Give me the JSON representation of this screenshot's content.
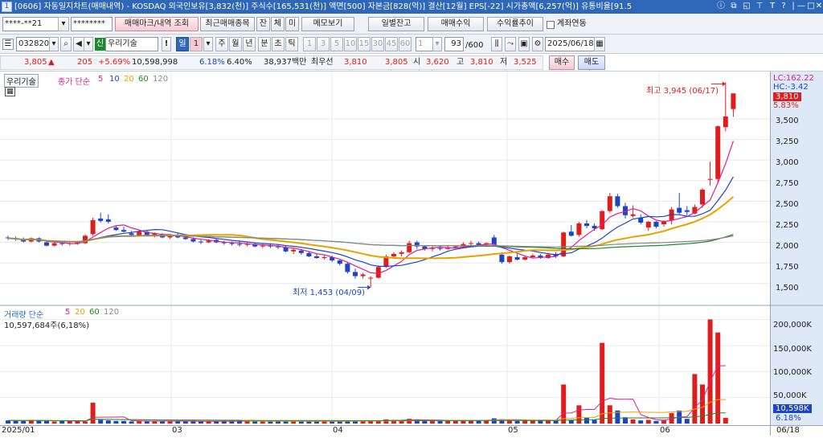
{
  "window": {
    "number": "1",
    "title": "[0606] 자동일지차트(매매내역) - KOSDAQ 외국인보유[3,832(천)] 주식수[165,531(천)] 액면[500] 자본금[828(억)] 결산[12월] EPS[-22] 시가총액[6,257(억)] 유통비율[91.5",
    "controls": [
      "ⓘ",
      "⧉",
      "◱",
      "⊤",
      "T",
      "?",
      "|",
      "—",
      "□",
      "✕"
    ]
  },
  "toolbar1": {
    "account": "****-**21",
    "password": "********",
    "buttons": [
      "매매마크/내역 조회",
      "최근매매종목",
      "잔",
      "체",
      "미",
      "메모보기",
      "일별잔고",
      "매매수익",
      "수익률추이"
    ],
    "checkbox_label": "계좌연동"
  },
  "toolbar2": {
    "code": "032820",
    "new_badge": "신",
    "stock_name": "우리기술",
    "periods": [
      "일",
      "1",
      "주",
      "월",
      "년",
      "분",
      "초",
      "틱"
    ],
    "intervals": [
      "1",
      "3",
      "5",
      "10",
      "15",
      "30",
      "45",
      "60"
    ],
    "interval_value": "1",
    "count": "93",
    "count_total": "/600",
    "date": "2025/06/18"
  },
  "quote": {
    "price": "3,805",
    "up_mark": "▲",
    "change": "205",
    "change_pct": "+5.69%",
    "volume": "10,598,998",
    "turnover": "6.18%",
    "ratio": "6.40%",
    "amount": "38,937백만",
    "best_ask_label": "최우선",
    "best_ask": "3,810",
    "best_bid": "3,805",
    "open_label": "시",
    "open": "3,620",
    "high_label": "고",
    "high": "3,810",
    "low_label": "저",
    "low": "3,525",
    "buy_button": "매수",
    "sell_button": "매도"
  },
  "price_pane": {
    "stock_label": "우리기술",
    "legend_title": "종가 단순",
    "legend_periods": [
      "5",
      "10",
      "20",
      "60",
      "120"
    ],
    "legend_colors": [
      "#e01d8a",
      "#1b44c8",
      "#e8a200",
      "#1b8a2a",
      "#888888"
    ],
    "lc_label": "LC:162.22",
    "hc_label": "HC:-3.42",
    "current_price_label": "3,810",
    "current_pct_label": "5.83%",
    "high_annotation": "최고 3,945 (06/17)",
    "low_annotation": "최저 1,453 (04/09)",
    "y_ticks": [
      "3,500",
      "3,250",
      "3,000",
      "2,750",
      "2,500",
      "2,250",
      "2,000",
      "1,750",
      "1,500"
    ]
  },
  "volume_pane": {
    "legend_title": "거래량 단순",
    "legend_periods": [
      "5",
      "20",
      "60",
      "120"
    ],
    "volume_text": "10,597,684주(6,18%)",
    "current_volume_label": "10,598K",
    "current_pct_label": "6.18%",
    "y_ticks": [
      "200,000K",
      "150,000K",
      "100,000K",
      "50,000K"
    ]
  },
  "x_axis": {
    "labels": [
      "2025/01",
      "03",
      "04",
      "05",
      "06",
      "06/18"
    ]
  },
  "chart_data": {
    "type": "candlestick",
    "title": "우리기술",
    "price_axis": {
      "min": 1400,
      "max": 3900
    },
    "volume_axis": {
      "min": 0,
      "max": 210000
    },
    "volume_unit": "K",
    "candles": [
      {
        "o": 2060,
        "h": 2080,
        "l": 2030,
        "c": 2050
      },
      {
        "o": 2050,
        "h": 2070,
        "l": 2020,
        "c": 2040
      },
      {
        "o": 2040,
        "h": 2060,
        "l": 2000,
        "c": 2010
      },
      {
        "o": 2010,
        "h": 2060,
        "l": 2000,
        "c": 2050
      },
      {
        "o": 2050,
        "h": 2060,
        "l": 2000,
        "c": 2010
      },
      {
        "o": 2000,
        "h": 2010,
        "l": 1950,
        "c": 1960
      },
      {
        "o": 1960,
        "h": 2000,
        "l": 1950,
        "c": 1990
      },
      {
        "o": 1990,
        "h": 2010,
        "l": 1960,
        "c": 1980
      },
      {
        "o": 1980,
        "h": 2000,
        "l": 1960,
        "c": 1990
      },
      {
        "o": 1990,
        "h": 2020,
        "l": 1970,
        "c": 2000
      },
      {
        "o": 1990,
        "h": 2100,
        "l": 1980,
        "c": 2080
      },
      {
        "o": 2100,
        "h": 2300,
        "l": 2080,
        "c": 2270
      },
      {
        "o": 2290,
        "h": 2360,
        "l": 2240,
        "c": 2260
      },
      {
        "o": 2280,
        "h": 2340,
        "l": 2230,
        "c": 2250
      },
      {
        "o": 2180,
        "h": 2200,
        "l": 2140,
        "c": 2150
      },
      {
        "o": 2150,
        "h": 2190,
        "l": 2120,
        "c": 2130
      },
      {
        "o": 2110,
        "h": 2140,
        "l": 2070,
        "c": 2090
      },
      {
        "o": 2080,
        "h": 2150,
        "l": 2070,
        "c": 2130
      },
      {
        "o": 2130,
        "h": 2140,
        "l": 2070,
        "c": 2090
      },
      {
        "o": 2090,
        "h": 2120,
        "l": 2060,
        "c": 2110
      },
      {
        "o": 2100,
        "h": 2110,
        "l": 2050,
        "c": 2060
      },
      {
        "o": 2060,
        "h": 2100,
        "l": 2040,
        "c": 2080
      },
      {
        "o": 2090,
        "h": 2110,
        "l": 2050,
        "c": 2060
      },
      {
        "o": 2060,
        "h": 2080,
        "l": 2030,
        "c": 2040
      },
      {
        "o": 2040,
        "h": 2060,
        "l": 2000,
        "c": 2010
      },
      {
        "o": 2010,
        "h": 2030,
        "l": 1980,
        "c": 2000
      },
      {
        "o": 2000,
        "h": 2040,
        "l": 1990,
        "c": 2020
      },
      {
        "o": 2030,
        "h": 2050,
        "l": 1990,
        "c": 2000
      },
      {
        "o": 2000,
        "h": 2020,
        "l": 1970,
        "c": 1990
      },
      {
        "o": 1990,
        "h": 2010,
        "l": 1960,
        "c": 1980
      },
      {
        "o": 1980,
        "h": 2010,
        "l": 1950,
        "c": 1970
      },
      {
        "o": 1970,
        "h": 2000,
        "l": 1950,
        "c": 1980
      },
      {
        "o": 1980,
        "h": 2000,
        "l": 1940,
        "c": 1950
      },
      {
        "o": 1950,
        "h": 1980,
        "l": 1930,
        "c": 1960
      },
      {
        "o": 1960,
        "h": 1990,
        "l": 1930,
        "c": 1950
      },
      {
        "o": 1950,
        "h": 1970,
        "l": 1920,
        "c": 1940
      },
      {
        "o": 1940,
        "h": 1960,
        "l": 1880,
        "c": 1890
      },
      {
        "o": 1890,
        "h": 1930,
        "l": 1860,
        "c": 1910
      },
      {
        "o": 1900,
        "h": 1920,
        "l": 1850,
        "c": 1870
      },
      {
        "o": 1870,
        "h": 1890,
        "l": 1820,
        "c": 1830
      },
      {
        "o": 1830,
        "h": 1860,
        "l": 1800,
        "c": 1810
      },
      {
        "o": 1810,
        "h": 1850,
        "l": 1790,
        "c": 1820
      },
      {
        "o": 1820,
        "h": 1840,
        "l": 1760,
        "c": 1780
      },
      {
        "o": 1780,
        "h": 1800,
        "l": 1720,
        "c": 1740
      },
      {
        "o": 1740,
        "h": 1760,
        "l": 1620,
        "c": 1640
      },
      {
        "o": 1640,
        "h": 1680,
        "l": 1560,
        "c": 1590
      },
      {
        "o": 1590,
        "h": 1630,
        "l": 1560,
        "c": 1610
      },
      {
        "o": 1560,
        "h": 1590,
        "l": 1453,
        "c": 1570
      },
      {
        "o": 1570,
        "h": 1720,
        "l": 1560,
        "c": 1700
      },
      {
        "o": 1700,
        "h": 1850,
        "l": 1690,
        "c": 1830
      },
      {
        "o": 1830,
        "h": 1880,
        "l": 1800,
        "c": 1860
      },
      {
        "o": 1860,
        "h": 1900,
        "l": 1830,
        "c": 1880
      },
      {
        "o": 1880,
        "h": 2020,
        "l": 1870,
        "c": 1990
      },
      {
        "o": 2000,
        "h": 2020,
        "l": 1920,
        "c": 1950
      },
      {
        "o": 1950,
        "h": 1960,
        "l": 1900,
        "c": 1920
      },
      {
        "o": 1920,
        "h": 1950,
        "l": 1890,
        "c": 1930
      },
      {
        "o": 1930,
        "h": 1960,
        "l": 1900,
        "c": 1920
      },
      {
        "o": 1920,
        "h": 1960,
        "l": 1910,
        "c": 1940
      },
      {
        "o": 1940,
        "h": 1960,
        "l": 1930,
        "c": 1950
      },
      {
        "o": 1950,
        "h": 2000,
        "l": 1930,
        "c": 1980
      },
      {
        "o": 1980,
        "h": 2020,
        "l": 1950,
        "c": 1990
      },
      {
        "o": 1990,
        "h": 2010,
        "l": 1960,
        "c": 1970
      },
      {
        "o": 1970,
        "h": 2000,
        "l": 1950,
        "c": 1990
      },
      {
        "o": 2060,
        "h": 2090,
        "l": 1960,
        "c": 1970
      },
      {
        "o": 1850,
        "h": 1880,
        "l": 1740,
        "c": 1760
      },
      {
        "o": 1760,
        "h": 1840,
        "l": 1740,
        "c": 1830
      },
      {
        "o": 1820,
        "h": 1860,
        "l": 1780,
        "c": 1790
      },
      {
        "o": 1790,
        "h": 1830,
        "l": 1780,
        "c": 1820
      },
      {
        "o": 1820,
        "h": 1860,
        "l": 1810,
        "c": 1840
      },
      {
        "o": 1840,
        "h": 1860,
        "l": 1800,
        "c": 1810
      },
      {
        "o": 1810,
        "h": 1870,
        "l": 1800,
        "c": 1850
      },
      {
        "o": 1860,
        "h": 1880,
        "l": 1810,
        "c": 1830
      },
      {
        "o": 1830,
        "h": 2130,
        "l": 1820,
        "c": 2120
      },
      {
        "o": 2130,
        "h": 2210,
        "l": 2070,
        "c": 2080
      },
      {
        "o": 2090,
        "h": 2250,
        "l": 2070,
        "c": 2230
      },
      {
        "o": 2230,
        "h": 2270,
        "l": 2170,
        "c": 2200
      },
      {
        "o": 2200,
        "h": 2230,
        "l": 2140,
        "c": 2170
      },
      {
        "o": 2160,
        "h": 2390,
        "l": 2150,
        "c": 2380
      },
      {
        "o": 2380,
        "h": 2600,
        "l": 2360,
        "c": 2560
      },
      {
        "o": 2560,
        "h": 2590,
        "l": 2420,
        "c": 2440
      },
      {
        "o": 2440,
        "h": 2480,
        "l": 2290,
        "c": 2330
      },
      {
        "o": 2320,
        "h": 2450,
        "l": 2300,
        "c": 2340
      },
      {
        "o": 2300,
        "h": 2340,
        "l": 2220,
        "c": 2240
      },
      {
        "o": 2180,
        "h": 2260,
        "l": 2140,
        "c": 2250
      },
      {
        "o": 2250,
        "h": 2260,
        "l": 2170,
        "c": 2190
      },
      {
        "o": 2220,
        "h": 2270,
        "l": 2190,
        "c": 2250
      },
      {
        "o": 2270,
        "h": 2430,
        "l": 2220,
        "c": 2400
      },
      {
        "o": 2420,
        "h": 2600,
        "l": 2340,
        "c": 2360
      },
      {
        "o": 2390,
        "h": 2440,
        "l": 2330,
        "c": 2370
      },
      {
        "o": 2350,
        "h": 2460,
        "l": 2340,
        "c": 2430
      },
      {
        "o": 2460,
        "h": 2660,
        "l": 2420,
        "c": 2640
      },
      {
        "o": 2760,
        "h": 2980,
        "l": 2690,
        "c": 2770
      },
      {
        "o": 2770,
        "h": 3420,
        "l": 2720,
        "c": 3410
      },
      {
        "o": 3400,
        "h": 3945,
        "l": 3350,
        "c": 3530
      },
      {
        "o": 3620,
        "h": 3810,
        "l": 3525,
        "c": 3810
      }
    ],
    "volume_k": [
      6,
      6,
      5,
      7,
      6,
      5,
      4,
      5,
      5,
      5,
      4,
      40,
      7,
      6,
      5,
      5,
      4,
      5,
      4,
      5,
      5,
      4,
      5,
      4,
      5,
      4,
      4,
      4,
      5,
      5,
      5,
      4,
      5,
      4,
      5,
      5,
      4,
      5,
      4,
      4,
      5,
      5,
      4,
      4,
      6,
      5,
      5,
      6,
      5,
      8,
      7,
      6,
      9,
      7,
      6,
      6,
      5,
      6,
      6,
      6,
      6,
      6,
      7,
      10,
      8,
      6,
      5,
      6,
      6,
      6,
      6,
      7,
      75,
      7,
      35,
      11,
      7,
      155,
      35,
      25,
      12,
      8,
      6,
      7,
      5,
      6,
      20,
      25,
      9,
      95,
      75,
      200,
      175,
      11
    ],
    "moving_averages": [
      "5",
      "10",
      "20",
      "60",
      "120"
    ]
  }
}
